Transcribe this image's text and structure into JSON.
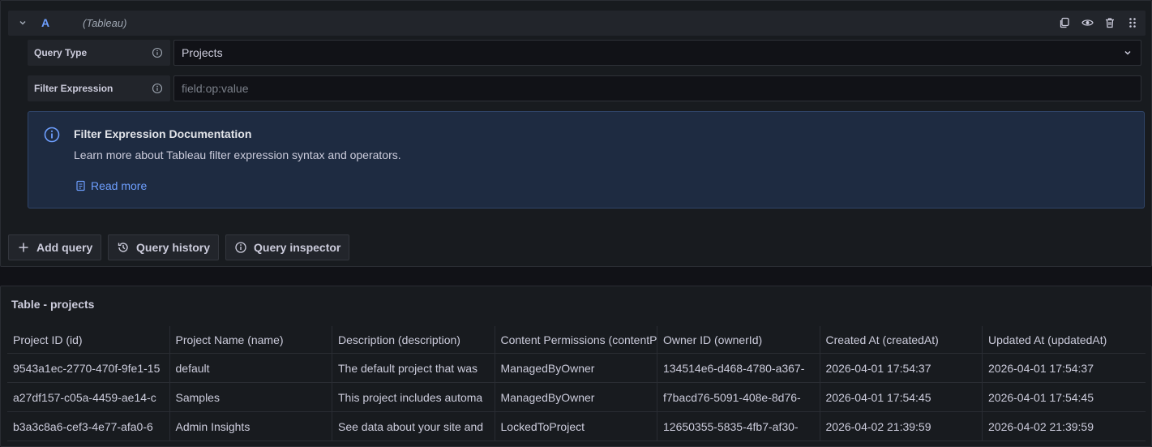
{
  "query": {
    "ref_id": "A",
    "datasource": "(Tableau)",
    "query_type_label": "Query Type",
    "query_type_value": "Projects",
    "filter_label": "Filter Expression",
    "filter_placeholder": "field:op:value",
    "filter_value": ""
  },
  "info_box": {
    "title": "Filter Expression Documentation",
    "description": "Learn more about Tableau filter expression syntax and operators.",
    "link": "Read more"
  },
  "actions": {
    "add_query": "Add query",
    "query_history": "Query history",
    "query_inspector": "Query inspector"
  },
  "table": {
    "title": "Table - projects",
    "columns": [
      "Project ID (id)",
      "Project Name (name)",
      "Description (description)",
      "Content Permissions (contentPermissions)",
      "Owner ID (ownerId)",
      "Created At (createdAt)",
      "Updated At (updatedAt)"
    ],
    "rows": [
      [
        "9543a1ec-2770-470f-9fe1-15",
        "default",
        "The default project that was",
        "ManagedByOwner",
        "134514e6-d468-4780-a367-",
        "2026-04-01 17:54:37",
        "2026-04-01 17:54:37"
      ],
      [
        "a27df157-c05a-4459-ae14-c",
        "Samples",
        "This project includes automa",
        "ManagedByOwner",
        "f7bacd76-5091-408e-8d76-",
        "2026-04-01 17:54:45",
        "2026-04-01 17:54:45"
      ],
      [
        "b3a3c8a6-cef3-4e77-afa0-6",
        "Admin Insights",
        "See data about your site and",
        "LockedToProject",
        "12650355-5835-4fb7-af30-",
        "2026-04-02 21:39:59",
        "2026-04-02 21:39:59"
      ]
    ]
  },
  "colors": {
    "accent": "#6e9fff",
    "panel_bg": "#181b1f",
    "info_bg": "#1e2b41"
  }
}
